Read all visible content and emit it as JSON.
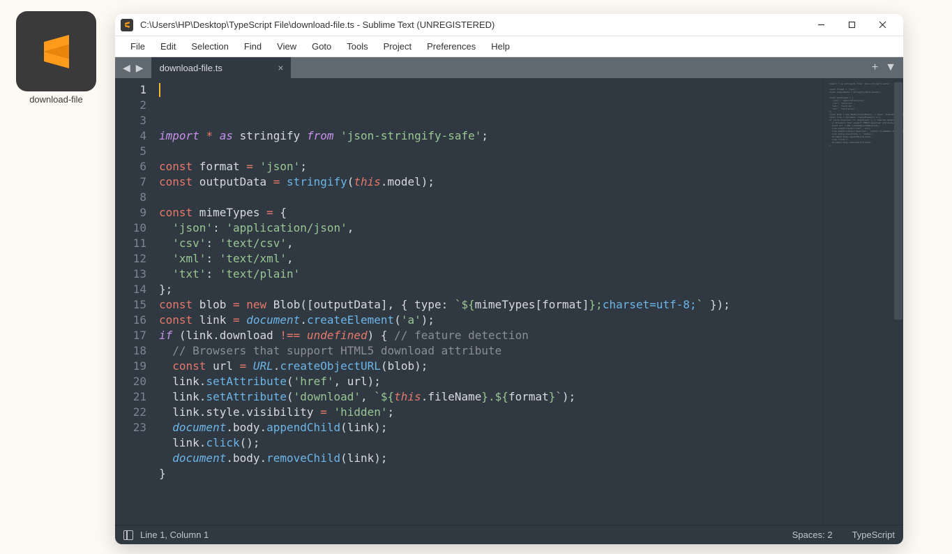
{
  "desktop_icon": {
    "label": "download-file"
  },
  "window": {
    "title": "C:\\Users\\HP\\Desktop\\TypeScript File\\download-file.ts - Sublime Text (UNREGISTERED)"
  },
  "menus": [
    "File",
    "Edit",
    "Selection",
    "Find",
    "View",
    "Goto",
    "Tools",
    "Project",
    "Preferences",
    "Help"
  ],
  "tab": {
    "label": "download-file.ts"
  },
  "line_count": 23,
  "current_line": 1,
  "statusbar": {
    "left": "Line 1, Column 1",
    "spaces": "Spaces: 2",
    "lang": "TypeScript"
  },
  "code_lines": [
    [
      [
        "kw",
        "import"
      ],
      [
        "pl",
        " "
      ],
      [
        "op",
        "*"
      ],
      [
        "pl",
        " "
      ],
      [
        "kw",
        "as"
      ],
      [
        "pl",
        " stringify "
      ],
      [
        "kw",
        "from"
      ],
      [
        "pl",
        " "
      ],
      [
        "str",
        "'json-stringify-safe'"
      ],
      [
        "pl",
        ";"
      ]
    ],
    [],
    [
      [
        "kw2",
        "const"
      ],
      [
        "pl",
        " format "
      ],
      [
        "op",
        "="
      ],
      [
        "pl",
        " "
      ],
      [
        "str",
        "'json'"
      ],
      [
        "pl",
        ";"
      ]
    ],
    [
      [
        "kw2",
        "const"
      ],
      [
        "pl",
        " outputData "
      ],
      [
        "op",
        "="
      ],
      [
        "pl",
        " "
      ],
      [
        "fn",
        "stringify"
      ],
      [
        "pl",
        "("
      ],
      [
        "self",
        "this"
      ],
      [
        "pl",
        ".model);"
      ]
    ],
    [],
    [
      [
        "kw2",
        "const"
      ],
      [
        "pl",
        " mimeTypes "
      ],
      [
        "op",
        "="
      ],
      [
        "pl",
        " {"
      ]
    ],
    [
      [
        "pl",
        "  "
      ],
      [
        "str",
        "'json'"
      ],
      [
        "pl",
        ": "
      ],
      [
        "str",
        "'application/json'"
      ],
      [
        "pl",
        ","
      ]
    ],
    [
      [
        "pl",
        "  "
      ],
      [
        "str",
        "'csv'"
      ],
      [
        "pl",
        ": "
      ],
      [
        "str",
        "'text/csv'"
      ],
      [
        "pl",
        ","
      ]
    ],
    [
      [
        "pl",
        "  "
      ],
      [
        "str",
        "'xml'"
      ],
      [
        "pl",
        ": "
      ],
      [
        "str",
        "'text/xml'"
      ],
      [
        "pl",
        ","
      ]
    ],
    [
      [
        "pl",
        "  "
      ],
      [
        "str",
        "'txt'"
      ],
      [
        "pl",
        ": "
      ],
      [
        "str",
        "'text/plain'"
      ]
    ],
    [
      [
        "pl",
        "};"
      ]
    ],
    [
      [
        "kw2",
        "const"
      ],
      [
        "pl",
        " blob "
      ],
      [
        "op",
        "="
      ],
      [
        "pl",
        " "
      ],
      [
        "op",
        "new"
      ],
      [
        "pl",
        " Blob([outputData], { type: "
      ],
      [
        "str",
        "`${"
      ],
      [
        "pl",
        "mimeTypes[format]"
      ],
      [
        "str",
        "};"
      ],
      [
        "fn",
        "charset=utf-8;"
      ],
      [
        "str",
        "`"
      ],
      [
        "pl",
        " });"
      ]
    ],
    [
      [
        "kw2",
        "const"
      ],
      [
        "pl",
        " link "
      ],
      [
        "op",
        "="
      ],
      [
        "pl",
        " "
      ],
      [
        "bi",
        "document"
      ],
      [
        "pl",
        "."
      ],
      [
        "fn",
        "createElement"
      ],
      [
        "pl",
        "("
      ],
      [
        "str",
        "'a'"
      ],
      [
        "pl",
        ");"
      ]
    ],
    [
      [
        "kw",
        "if"
      ],
      [
        "pl",
        " (link.download "
      ],
      [
        "op",
        "!=="
      ],
      [
        "pl",
        " "
      ],
      [
        "undef",
        "undefined"
      ],
      [
        "pl",
        ") { "
      ],
      [
        "cm",
        "// feature detection"
      ]
    ],
    [
      [
        "pl",
        "  "
      ],
      [
        "cm",
        "// Browsers that support HTML5 download attribute"
      ]
    ],
    [
      [
        "pl",
        "  "
      ],
      [
        "kw2",
        "const"
      ],
      [
        "pl",
        " url "
      ],
      [
        "op",
        "="
      ],
      [
        "pl",
        " "
      ],
      [
        "bi",
        "URL"
      ],
      [
        "pl",
        "."
      ],
      [
        "fn",
        "createObjectURL"
      ],
      [
        "pl",
        "(blob);"
      ]
    ],
    [
      [
        "pl",
        "  link."
      ],
      [
        "fn",
        "setAttribute"
      ],
      [
        "pl",
        "("
      ],
      [
        "str",
        "'href'"
      ],
      [
        "pl",
        ", url);"
      ]
    ],
    [
      [
        "pl",
        "  link."
      ],
      [
        "fn",
        "setAttribute"
      ],
      [
        "pl",
        "("
      ],
      [
        "str",
        "'download'"
      ],
      [
        "pl",
        ", "
      ],
      [
        "str",
        "`${"
      ],
      [
        "self",
        "this"
      ],
      [
        "pl",
        ".fileName"
      ],
      [
        "str",
        "}.${"
      ],
      [
        "pl",
        "format"
      ],
      [
        "str",
        "}`"
      ],
      [
        "pl",
        ");"
      ]
    ],
    [
      [
        "pl",
        "  link.style.visibility "
      ],
      [
        "op",
        "="
      ],
      [
        "pl",
        " "
      ],
      [
        "str",
        "'hidden'"
      ],
      [
        "pl",
        ";"
      ]
    ],
    [
      [
        "pl",
        "  "
      ],
      [
        "bi",
        "document"
      ],
      [
        "pl",
        ".body."
      ],
      [
        "fn",
        "appendChild"
      ],
      [
        "pl",
        "(link);"
      ]
    ],
    [
      [
        "pl",
        "  link."
      ],
      [
        "fn",
        "click"
      ],
      [
        "pl",
        "();"
      ]
    ],
    [
      [
        "pl",
        "  "
      ],
      [
        "bi",
        "document"
      ],
      [
        "pl",
        ".body."
      ],
      [
        "fn",
        "removeChild"
      ],
      [
        "pl",
        "(link);"
      ]
    ],
    [
      [
        "pl",
        "}"
      ]
    ]
  ]
}
